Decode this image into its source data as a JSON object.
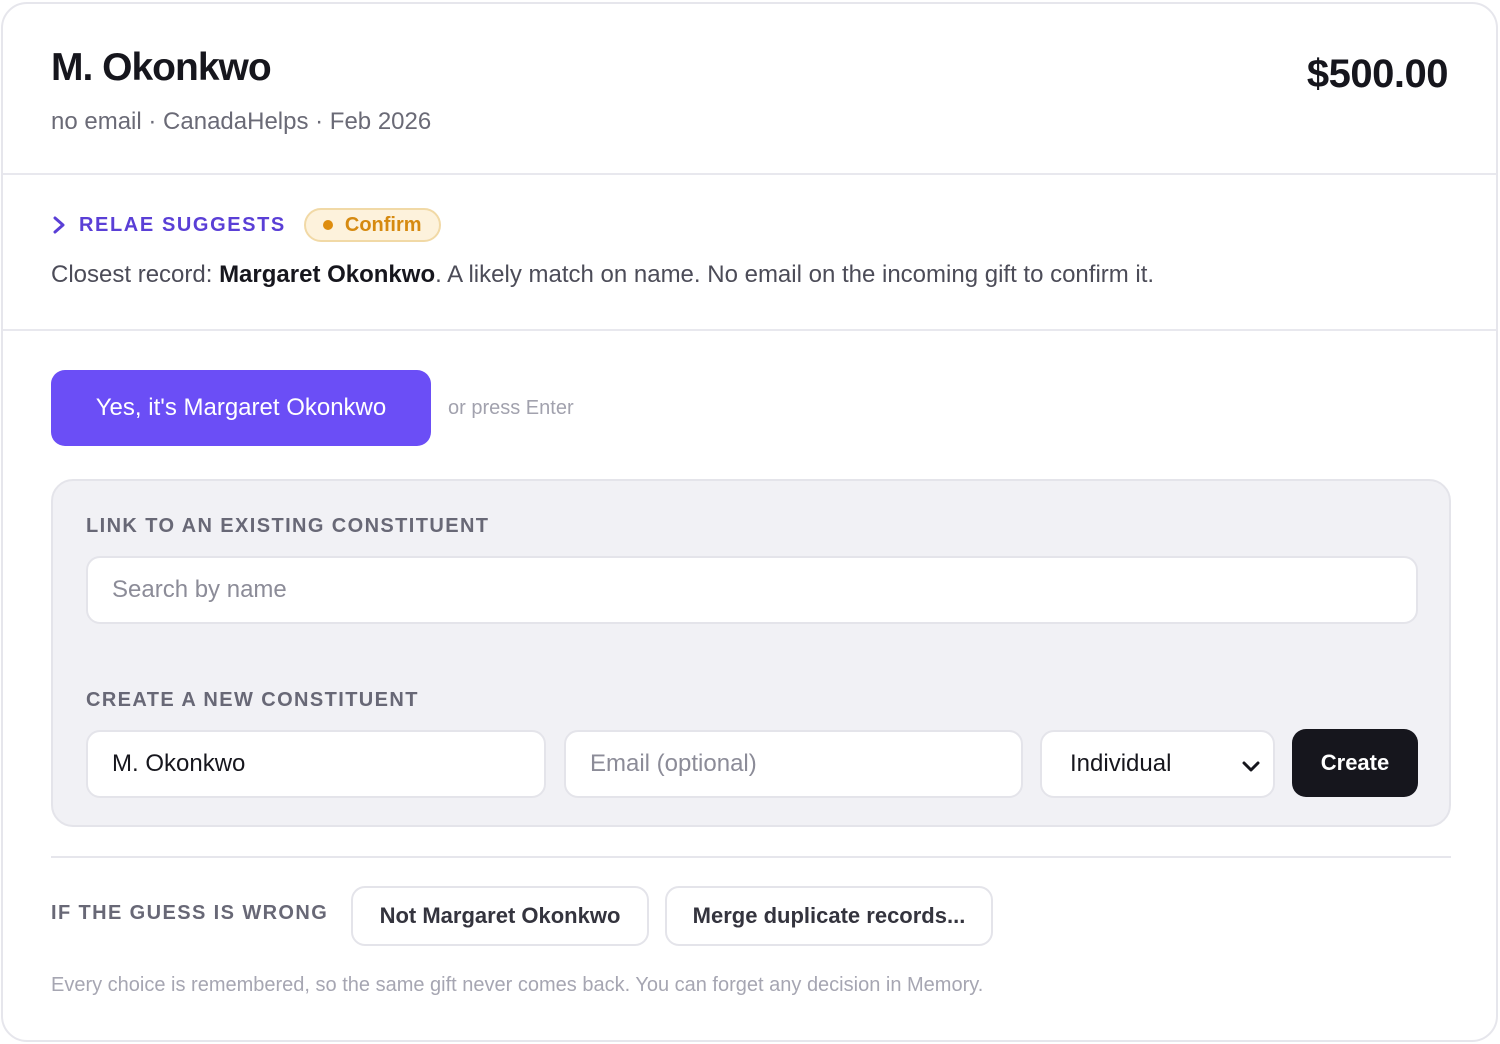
{
  "header": {
    "donor_name": "M. Okonkwo",
    "meta": "no email · CanadaHelps · Feb 2026",
    "amount": "$500.00"
  },
  "suggestion": {
    "label": "RELAE SUGGESTS",
    "badge": "Confirm",
    "text_prefix": "Closest record: ",
    "record_name": "Margaret Okonkwo",
    "text_suffix": ". A likely match on name. No email on the incoming gift to confirm it."
  },
  "primary_action": {
    "label": "Yes, it's Margaret Okonkwo",
    "hint": "or press Enter"
  },
  "link_section": {
    "label": "LINK TO AN EXISTING CONSTITUENT",
    "search_placeholder": "Search by name"
  },
  "create_section": {
    "label": "CREATE A NEW CONSTITUENT",
    "name_value": "M. Okonkwo",
    "email_placeholder": "Email (optional)",
    "type_selected": "Individual",
    "create_label": "Create"
  },
  "wrong_section": {
    "label": "IF THE GUESS IS WRONG",
    "not_button": "Not Margaret Okonkwo",
    "merge_button": "Merge duplicate records..."
  },
  "footnote": "Every choice is remembered, so the same gift never comes back. You can forget any decision in Memory.",
  "colors": {
    "accent": "#6b4ef6",
    "suggest_label": "#5a3fd6",
    "badge_text": "#d68a10",
    "badge_bg": "#fdf2dc",
    "dark_button": "#16161d"
  },
  "icons": {
    "suggest": "chevron-right-icon",
    "select": "chevron-down-icon"
  }
}
